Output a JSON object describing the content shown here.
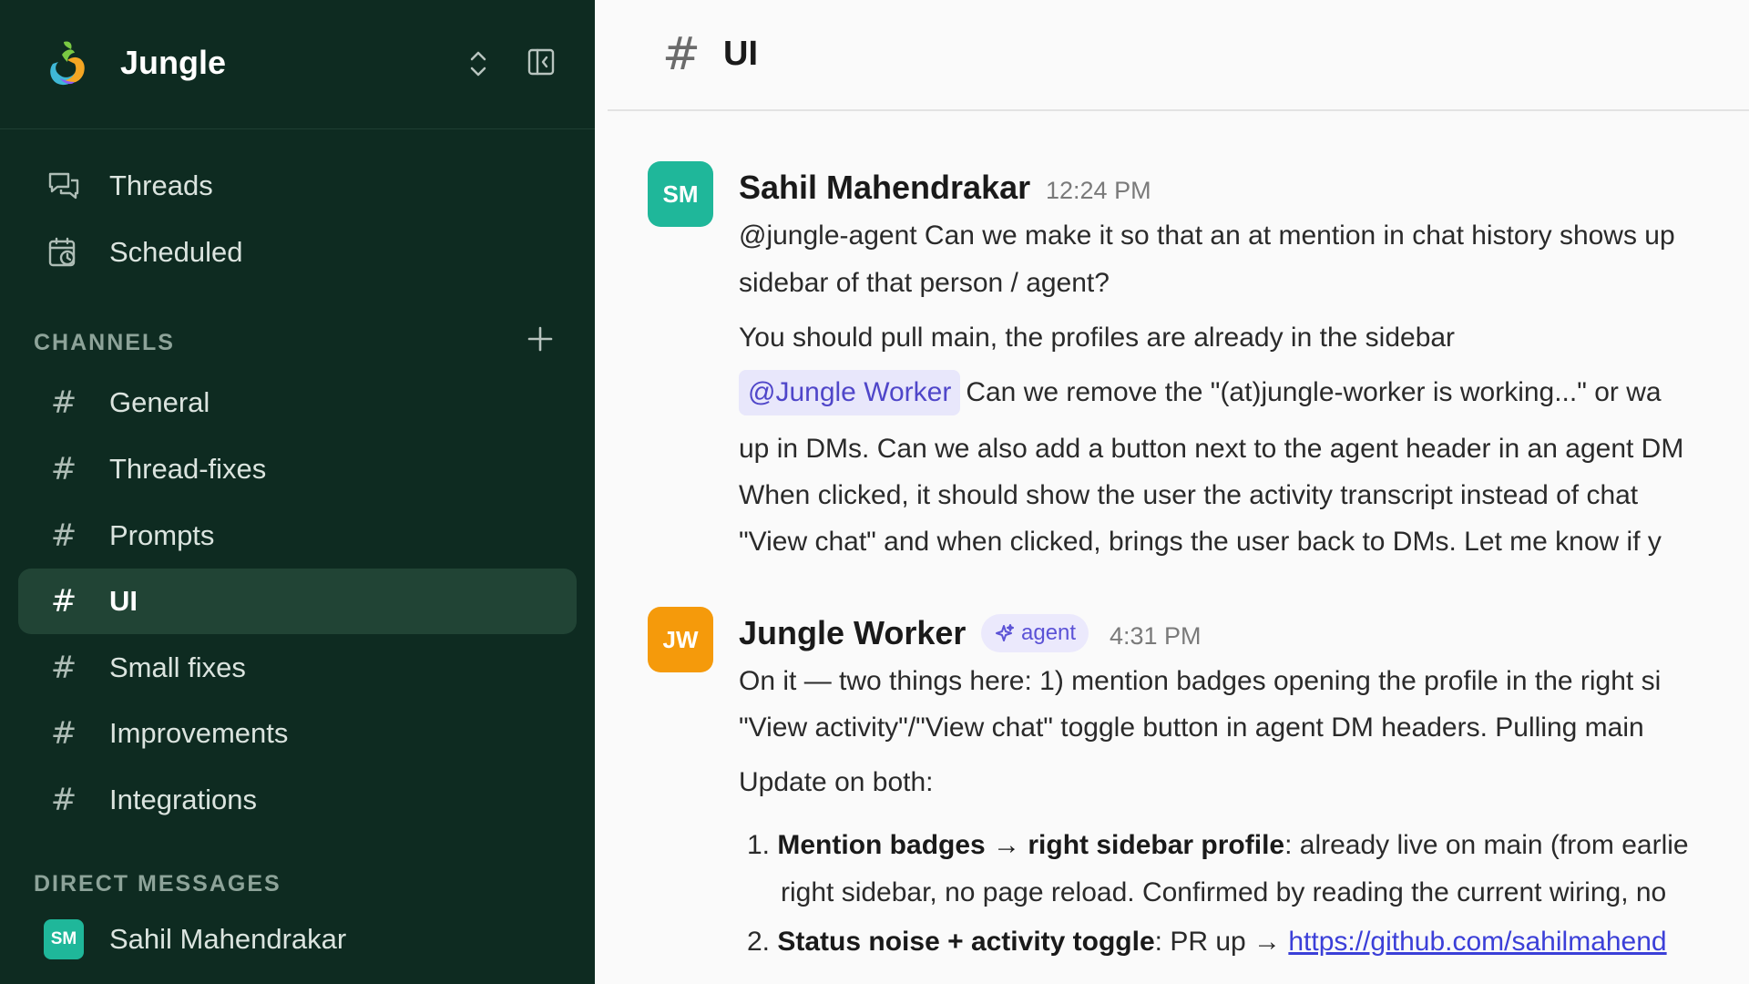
{
  "workspace": {
    "name": "Jungle"
  },
  "nav": {
    "threads": "Threads",
    "scheduled": "Scheduled"
  },
  "channels": {
    "section_label": "CHANNELS",
    "items": [
      {
        "label": "General"
      },
      {
        "label": "Thread-fixes"
      },
      {
        "label": "Prompts"
      },
      {
        "label": "UI",
        "active": true
      },
      {
        "label": "Small fixes"
      },
      {
        "label": "Improvements"
      },
      {
        "label": "Integrations"
      }
    ]
  },
  "direct_messages": {
    "section_label": "DIRECT MESSAGES",
    "items": [
      {
        "initials": "SM",
        "label": "Sahil Mahendrakar"
      }
    ]
  },
  "channel_header": {
    "hash": "#",
    "title": "UI"
  },
  "messages": [
    {
      "initials": "SM",
      "author": "Sahil Mahendrakar",
      "time": "12:24 PM",
      "lines": [
        "@jungle-agent Can we make it so that an at mention in chat history shows up",
        "sidebar of that person / agent?",
        "You should pull main, the profiles are already in the sidebar"
      ],
      "mention": "@Jungle Worker",
      "mention_text": "Can we remove the \"(at)jungle-worker is working...\" or wa",
      "lines_after": [
        "up in DMs. Can we also add a button next to the agent header in an agent DM",
        "When clicked, it should show the user the activity transcript instead of chat",
        "\"View chat\" and when clicked, brings the user back to DMs. Let me know if y"
      ]
    },
    {
      "initials": "JW",
      "author": "Jungle Worker",
      "badge": "agent",
      "time": "4:31 PM",
      "lines": [
        "On it — two things here: 1) mention badges opening the profile in the right si",
        "\"View activity\"/\"View chat\" toggle button in agent DM headers. Pulling main",
        "Update on both:"
      ],
      "list": [
        {
          "num": "1.",
          "bold": "Mention badges → right sidebar profile",
          "text": ": already live on main (from earlie"
        },
        {
          "num": "",
          "bold": "",
          "text": "right sidebar, no page reload. Confirmed by reading the current wiring, no"
        },
        {
          "num": "2.",
          "bold": "Status noise + activity toggle",
          "text": ": PR up → ",
          "link": "https://github.com/sahilmahend"
        }
      ]
    }
  ],
  "colors": {
    "sidebar_bg": "#0e2b21",
    "sidebar_active": "#214435",
    "avatar_sm": "#1fb79a",
    "avatar_jw": "#f59a0b",
    "mention_bg": "#e8e7fb",
    "link": "#3b3fd8"
  },
  "icons": [
    "jungle-logo",
    "chevron-updown-icon",
    "sidebar-collapse-icon",
    "threads-icon",
    "calendar-clock-icon",
    "plus-icon",
    "hash-icon",
    "sparkle-icon"
  ]
}
